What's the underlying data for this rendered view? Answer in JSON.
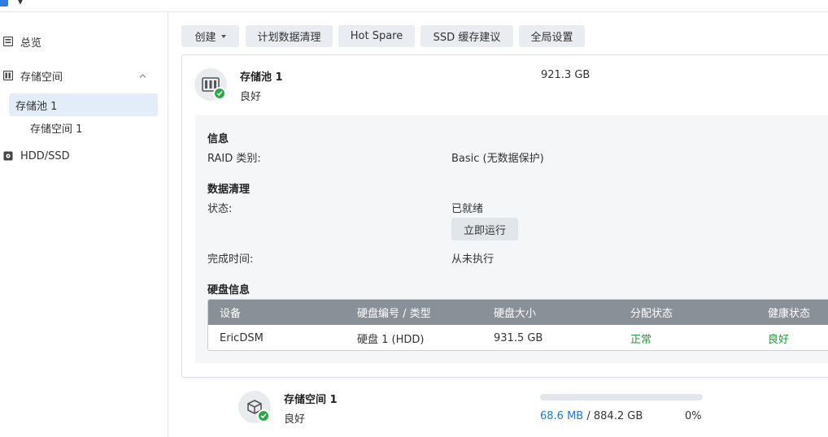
{
  "window": {
    "title": "▼"
  },
  "sidebar": {
    "items": [
      {
        "label": "总览",
        "icon": "overview-icon"
      },
      {
        "label": "存储空间",
        "icon": "storage-icon",
        "expanded": true
      },
      {
        "label": "存储池 1",
        "selected": true
      },
      {
        "label": "存储空间 1"
      },
      {
        "label": "HDD/SSD",
        "icon": "disk-icon"
      }
    ]
  },
  "toolbar": {
    "create": "创建",
    "scrub_schedule": "计划数据清理",
    "hot_spare": "Hot Spare",
    "ssd_cache": "SSD 缓存建议",
    "global_settings": "全局设置"
  },
  "pool": {
    "name": "存储池 1",
    "status": "良好",
    "capacity": "921.3 GB",
    "info_title": "信息",
    "raid_label": "RAID 类别:",
    "raid_value": "Basic (无数据保护)",
    "scrub_title": "数据清理",
    "state_label": "状态:",
    "state_value": "已就绪",
    "run_now": "立即运行",
    "finish_label": "完成时间:",
    "finish_value": "从未执行",
    "disk_title": "硬盘信息",
    "disk_table": {
      "headers": [
        "设备",
        "硬盘编号 / 类型",
        "硬盘大小",
        "分配状态",
        "健康状态"
      ],
      "rows": [
        [
          "EricDSM",
          "硬盘 1 (HDD)",
          "931.5 GB",
          "正常",
          "良好"
        ]
      ]
    }
  },
  "volume": {
    "name": "存储空间 1",
    "status": "良好",
    "used": "68.6 MB",
    "separator": "/",
    "total": "884.2 GB",
    "percent_text": "0%",
    "usage_fraction": 0.0
  },
  "colors": {
    "ok_green": "#27a844",
    "link_blue": "#1a79d0",
    "selected_bg": "#e3edf9",
    "table_header": "#8a9097"
  }
}
